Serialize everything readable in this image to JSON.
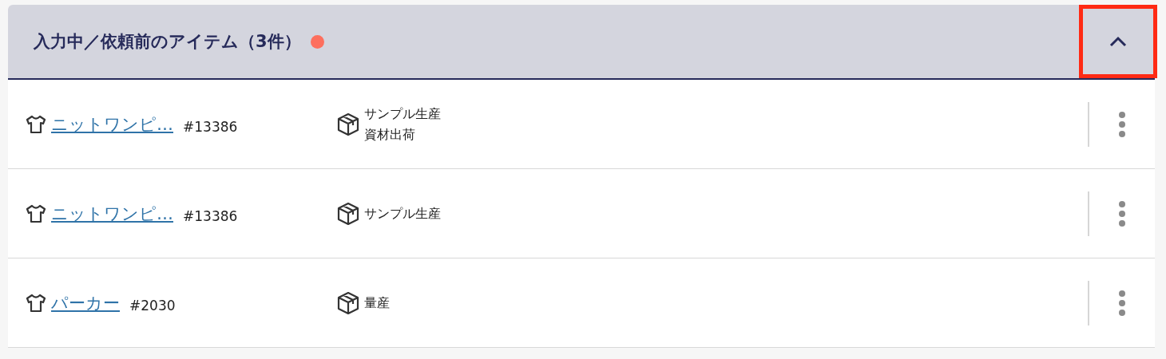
{
  "section": {
    "title": "入力中／依頼前のアイテム（3件）",
    "alert": true,
    "toggle": {
      "expanded": true,
      "highlighted": true
    }
  },
  "items": [
    {
      "name": "ニットワンピ…",
      "number": "#13386",
      "categories": [
        "サンプル生産",
        "資材出荷"
      ]
    },
    {
      "name": "ニットワンピ…",
      "number": "#13386",
      "categories": [
        "サンプル生産"
      ]
    },
    {
      "name": "パーカー",
      "number": "#2030",
      "categories": [
        "量産"
      ]
    }
  ]
}
